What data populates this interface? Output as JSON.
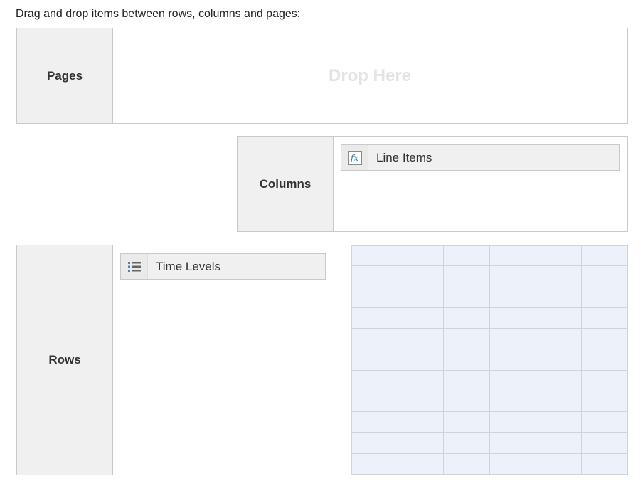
{
  "instructions": "Drag and drop items between rows, columns and pages:",
  "pages": {
    "label": "Pages",
    "drop_hint": "Drop Here"
  },
  "columns": {
    "label": "Columns",
    "items": [
      {
        "label": "Line Items",
        "icon": "fx-icon"
      }
    ]
  },
  "rows": {
    "label": "Rows",
    "items": [
      {
        "label": "Time Levels",
        "icon": "list-icon"
      }
    ]
  },
  "preview_grid": {
    "rows": 11,
    "cols": 6,
    "cell_color": "#edf2fa",
    "border_color": "#cfd4da"
  }
}
